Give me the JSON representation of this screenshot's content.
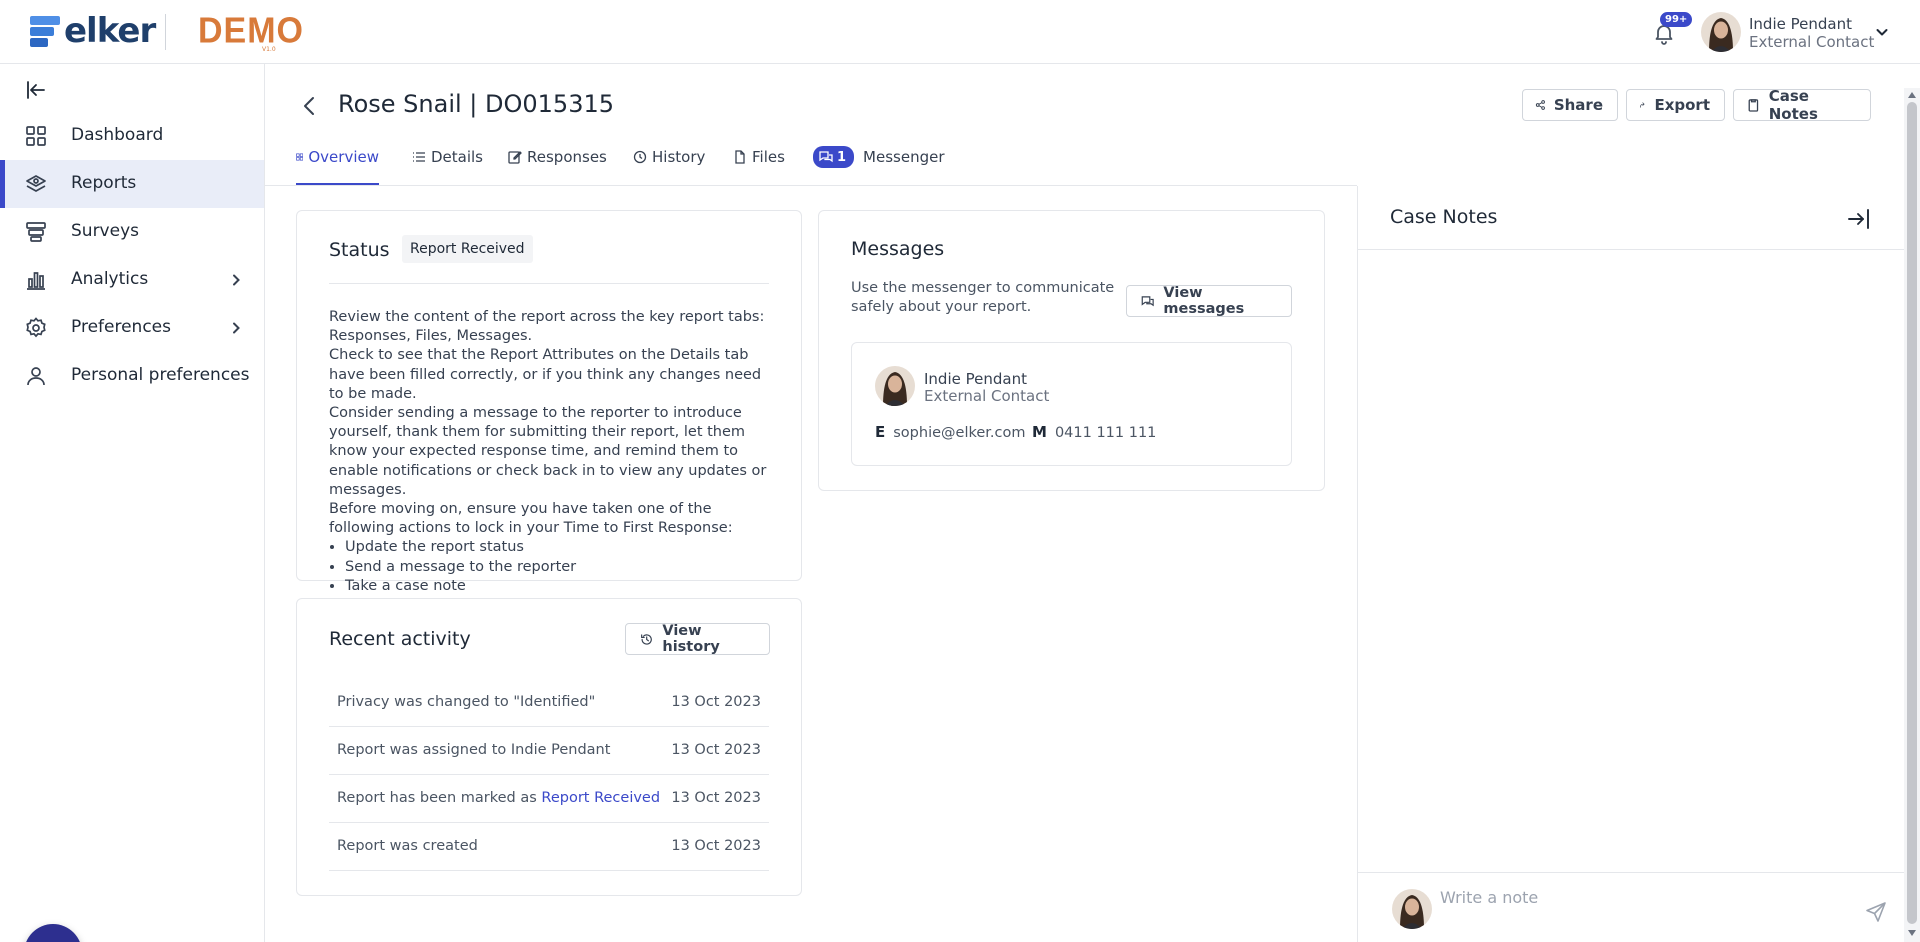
{
  "brand": {
    "logo_text": "elker",
    "demo_label": "DEMO",
    "demo_sub": "V1.0",
    "accent_color": "#3b49c9"
  },
  "topbar": {
    "notification_badge": "99+",
    "user_name": "Indie Pendant",
    "user_role": "External Contact"
  },
  "sidebar": {
    "items": [
      {
        "label": "Dashboard",
        "icon": "dashboard-grid-icon"
      },
      {
        "label": "Reports",
        "icon": "reports-icon",
        "active": true
      },
      {
        "label": "Surveys",
        "icon": "surveys-icon"
      },
      {
        "label": "Analytics",
        "icon": "bar-chart-icon",
        "has_children": true
      },
      {
        "label": "Preferences",
        "icon": "gear-icon",
        "has_children": true
      },
      {
        "label": "Personal preferences",
        "icon": "user-icon"
      }
    ]
  },
  "header": {
    "title": "Rose Snail | DO015315",
    "buttons": {
      "share": "Share",
      "export": "Export",
      "case_notes": "Case Notes"
    }
  },
  "tabs": [
    {
      "label": "Overview",
      "active": true
    },
    {
      "label": "Details"
    },
    {
      "label": "Responses"
    },
    {
      "label": "History"
    },
    {
      "label": "Files"
    },
    {
      "label": "Messenger",
      "badge": "1"
    }
  ],
  "status_card": {
    "title": "Status",
    "status": "Report Received",
    "paragraphs": [
      "Review the content of the report across the key report tabs: Responses, Files, Messages.",
      "Check to see that the Report Attributes on the Details tab have been filled correctly, or if you think any changes need to be made.",
      "Consider sending a message to the reporter to introduce yourself, thank them for submitting their report, let them know your expected response time, and remind them to enable notifications or check back in to view any updates or messages.",
      "Before moving on, ensure you have taken one of the following actions to lock in your Time to First Response:"
    ],
    "actions": [
      "Update the report status",
      "Send a message to the reporter",
      "Take a case note"
    ]
  },
  "activity_card": {
    "title": "Recent activity",
    "view_history": "View history",
    "rows": [
      {
        "text": "Privacy was changed to \"Identified\"",
        "date": "13 Oct 2023"
      },
      {
        "text": "Report was assigned to Indie Pendant",
        "date": "13 Oct 2023"
      },
      {
        "text": "Report has been marked as ",
        "link": "Report Received",
        "date": "13 Oct 2023"
      },
      {
        "text": "Report was created",
        "date": "13 Oct 2023"
      }
    ]
  },
  "messages_card": {
    "title": "Messages",
    "description": "Use the messenger to communicate safely about your report.",
    "view_messages": "View messages",
    "contact": {
      "name": "Indie Pendant",
      "role": "External Contact",
      "email_label": "E",
      "email": "sophie@elker.com",
      "mobile_label": "M",
      "mobile": "0411 111 111"
    }
  },
  "case_notes": {
    "title": "Case Notes",
    "placeholder": "Write a note"
  }
}
